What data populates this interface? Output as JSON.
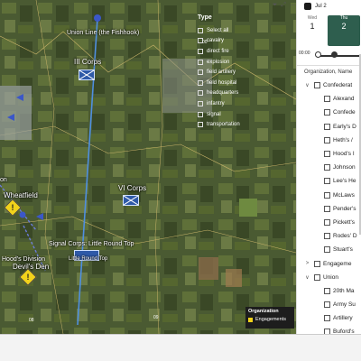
{
  "map": {
    "labels": {
      "union_line": "Union Line (the Fishhook)",
      "iii_corps": "III Corps",
      "vi_corps": "VI Corps",
      "wheatfield": "Wheatfield",
      "on": "on",
      "signal_corps": "Signal Corps: Little Round Top",
      "little_round_top": "Little Round Top",
      "hoods_division": "Hood's Division",
      "devils_den": "Devil's Den",
      "tick_08": "08",
      "tick_09": "09",
      "tick_00": "00"
    },
    "legend_type": {
      "title": "Type",
      "items": [
        "Select all",
        "cavalry",
        "direct fire",
        "explosion",
        "field artillery",
        "field hospital",
        "headquarters",
        "infantry",
        "signal",
        "transportation"
      ]
    },
    "legend_org": {
      "title": "Organization",
      "item": "Engagements",
      "color": "#f2d21b"
    },
    "pin_glyph": "!"
  },
  "toolbar": {
    "icons": [
      "filter-icon",
      "focus-icon",
      "more-icon"
    ]
  },
  "slicer": {
    "date": "Jul 2",
    "days": [
      {
        "weekday": "Wed",
        "num": "1"
      },
      {
        "weekday": "Thu",
        "num": "2"
      }
    ],
    "time_start": "00:00",
    "time_end": "00:00"
  },
  "organizations": {
    "header": "Organization, Name",
    "rows": [
      {
        "label": "Confederat",
        "level": 0,
        "chevron": "∨"
      },
      {
        "label": "Alexand",
        "level": 1
      },
      {
        "label": "Confede",
        "level": 1
      },
      {
        "label": "Early's D",
        "level": 1
      },
      {
        "label": "Heth's /",
        "level": 1
      },
      {
        "label": "Hood's I",
        "level": 1
      },
      {
        "label": "Johnson",
        "level": 1
      },
      {
        "label": "Lee's He",
        "level": 1
      },
      {
        "label": "McLaws",
        "level": 1
      },
      {
        "label": "Pender's",
        "level": 1
      },
      {
        "label": "Pickett's",
        "level": 1
      },
      {
        "label": "Rodes' D",
        "level": 1
      },
      {
        "label": "Stuart's",
        "level": 1
      },
      {
        "label": "Engageme",
        "level": 0,
        "chevron": ">"
      },
      {
        "label": "Union",
        "level": 0,
        "chevron": "∨"
      },
      {
        "label": "20th Ma",
        "level": 1
      },
      {
        "label": "Army Su",
        "level": 1
      },
      {
        "label": "Artillery",
        "level": 1
      },
      {
        "label": "Buford's",
        "level": 1
      }
    ]
  },
  "colors": {
    "accent": "#2e5e4e",
    "unit_blue": "#2f5aa8",
    "engagement": "#f2d21b"
  }
}
